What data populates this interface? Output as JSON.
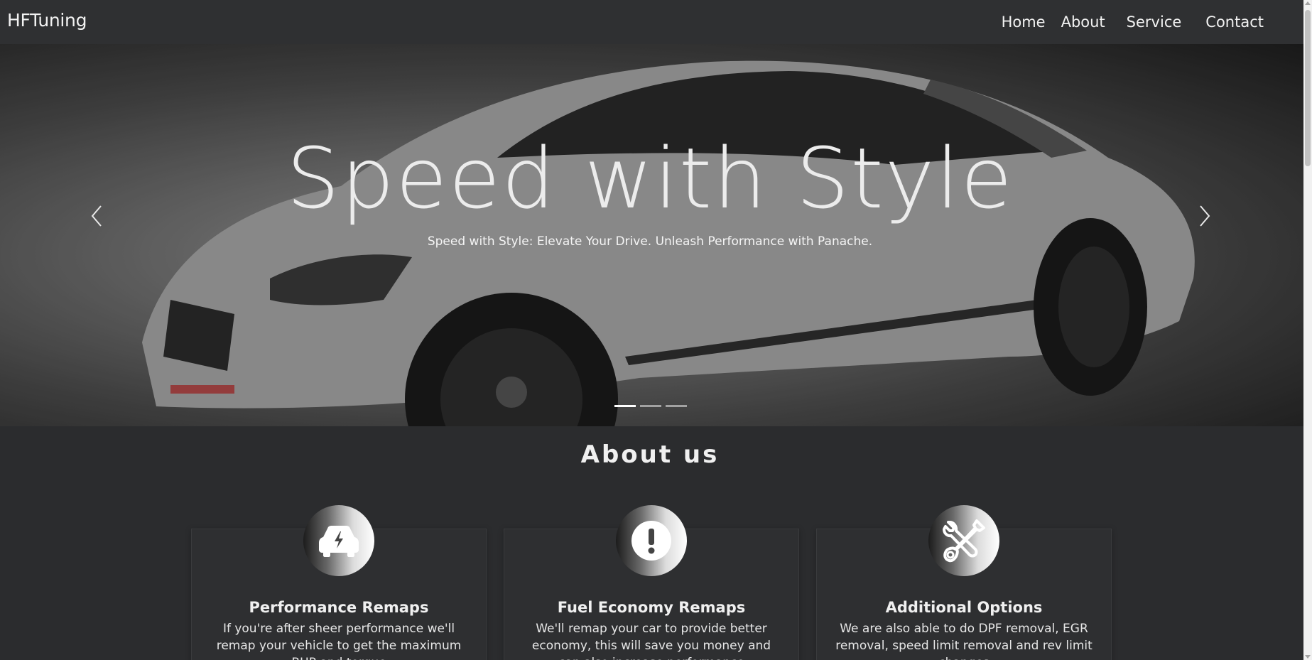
{
  "navbar": {
    "brand": "HFTuning",
    "links": [
      "Home",
      "About",
      "Service",
      "Contact"
    ]
  },
  "hero": {
    "title": "Speed with Style",
    "subtitle": "Speed with Style: Elevate Your Drive. Unleash Performance with Panache.",
    "slides_count": 3,
    "active_slide": 1
  },
  "about": {
    "title": "About us",
    "cards": [
      {
        "icon": "car-bolt-icon",
        "title": "Performance Remaps",
        "text": "If you're after sheer performance we'll remap your vehicle to get the maximum BHP and torque"
      },
      {
        "icon": "exclamation-circle-icon",
        "title": "Fuel Economy Remaps",
        "text": "We'll remap your car to provide better economy, this will save you money and can also increase performance"
      },
      {
        "icon": "wrench-screwdriver-icon",
        "title": "Additional Options",
        "text": "We are also able to do DPF removal, EGR removal, speed limit removal and rev limit changes"
      }
    ]
  },
  "colors": {
    "background": "#2b2c2e",
    "navbar": "#2f3032",
    "text": "#f0f0f0"
  }
}
